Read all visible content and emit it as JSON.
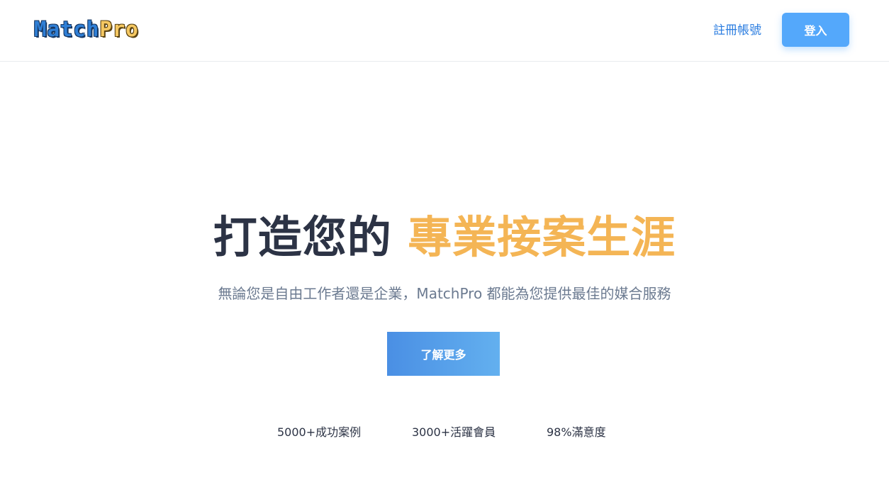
{
  "header": {
    "logo_part1": "Match",
    "logo_part2": "Pro",
    "register_label": "註冊帳號",
    "login_label": "登入"
  },
  "hero": {
    "title_prefix": "打造您的 ",
    "title_highlight": "專業接案生涯",
    "subtitle": "無論您是自由工作者還是企業，MatchPro 都能為您提供最佳的媒合服務",
    "cta_label": "了解更多"
  },
  "stats": [
    {
      "label": "5000+成功案例"
    },
    {
      "label": "3000+活躍會員"
    },
    {
      "label": "98%滿意度"
    }
  ],
  "colors": {
    "accent_blue": "#54a8fb",
    "accent_orange": "#f4b555",
    "link_blue": "#2b7de0",
    "title_dark": "#2c3345",
    "subtitle_gray": "#6b7a90"
  }
}
